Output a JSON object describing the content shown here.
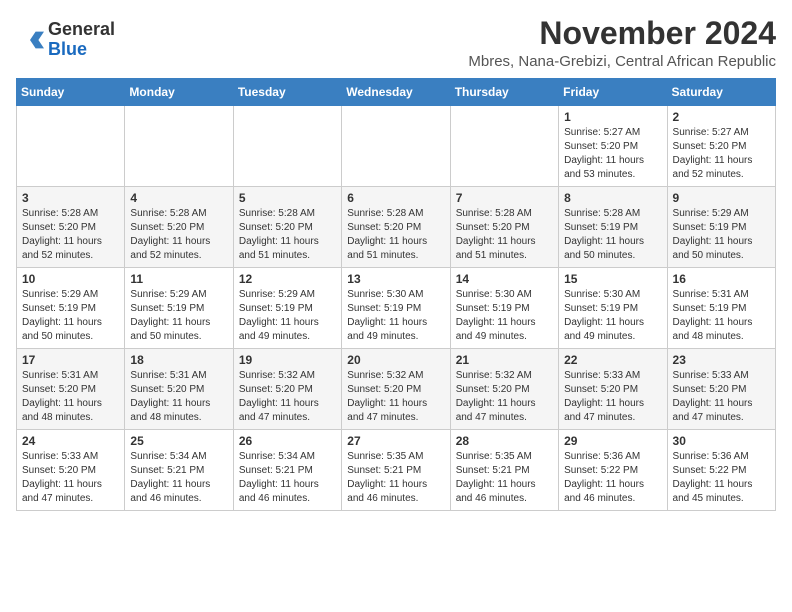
{
  "header": {
    "logo_general": "General",
    "logo_blue": "Blue",
    "month_title": "November 2024",
    "subtitle": "Mbres, Nana-Grebizi, Central African Republic"
  },
  "days_of_week": [
    "Sunday",
    "Monday",
    "Tuesday",
    "Wednesday",
    "Thursday",
    "Friday",
    "Saturday"
  ],
  "weeks": [
    [
      {
        "day": "",
        "info": ""
      },
      {
        "day": "",
        "info": ""
      },
      {
        "day": "",
        "info": ""
      },
      {
        "day": "",
        "info": ""
      },
      {
        "day": "",
        "info": ""
      },
      {
        "day": "1",
        "info": "Sunrise: 5:27 AM\nSunset: 5:20 PM\nDaylight: 11 hours and 53 minutes."
      },
      {
        "day": "2",
        "info": "Sunrise: 5:27 AM\nSunset: 5:20 PM\nDaylight: 11 hours and 52 minutes."
      }
    ],
    [
      {
        "day": "3",
        "info": "Sunrise: 5:28 AM\nSunset: 5:20 PM\nDaylight: 11 hours and 52 minutes."
      },
      {
        "day": "4",
        "info": "Sunrise: 5:28 AM\nSunset: 5:20 PM\nDaylight: 11 hours and 52 minutes."
      },
      {
        "day": "5",
        "info": "Sunrise: 5:28 AM\nSunset: 5:20 PM\nDaylight: 11 hours and 51 minutes."
      },
      {
        "day": "6",
        "info": "Sunrise: 5:28 AM\nSunset: 5:20 PM\nDaylight: 11 hours and 51 minutes."
      },
      {
        "day": "7",
        "info": "Sunrise: 5:28 AM\nSunset: 5:20 PM\nDaylight: 11 hours and 51 minutes."
      },
      {
        "day": "8",
        "info": "Sunrise: 5:28 AM\nSunset: 5:19 PM\nDaylight: 11 hours and 50 minutes."
      },
      {
        "day": "9",
        "info": "Sunrise: 5:29 AM\nSunset: 5:19 PM\nDaylight: 11 hours and 50 minutes."
      }
    ],
    [
      {
        "day": "10",
        "info": "Sunrise: 5:29 AM\nSunset: 5:19 PM\nDaylight: 11 hours and 50 minutes."
      },
      {
        "day": "11",
        "info": "Sunrise: 5:29 AM\nSunset: 5:19 PM\nDaylight: 11 hours and 50 minutes."
      },
      {
        "day": "12",
        "info": "Sunrise: 5:29 AM\nSunset: 5:19 PM\nDaylight: 11 hours and 49 minutes."
      },
      {
        "day": "13",
        "info": "Sunrise: 5:30 AM\nSunset: 5:19 PM\nDaylight: 11 hours and 49 minutes."
      },
      {
        "day": "14",
        "info": "Sunrise: 5:30 AM\nSunset: 5:19 PM\nDaylight: 11 hours and 49 minutes."
      },
      {
        "day": "15",
        "info": "Sunrise: 5:30 AM\nSunset: 5:19 PM\nDaylight: 11 hours and 49 minutes."
      },
      {
        "day": "16",
        "info": "Sunrise: 5:31 AM\nSunset: 5:19 PM\nDaylight: 11 hours and 48 minutes."
      }
    ],
    [
      {
        "day": "17",
        "info": "Sunrise: 5:31 AM\nSunset: 5:20 PM\nDaylight: 11 hours and 48 minutes."
      },
      {
        "day": "18",
        "info": "Sunrise: 5:31 AM\nSunset: 5:20 PM\nDaylight: 11 hours and 48 minutes."
      },
      {
        "day": "19",
        "info": "Sunrise: 5:32 AM\nSunset: 5:20 PM\nDaylight: 11 hours and 47 minutes."
      },
      {
        "day": "20",
        "info": "Sunrise: 5:32 AM\nSunset: 5:20 PM\nDaylight: 11 hours and 47 minutes."
      },
      {
        "day": "21",
        "info": "Sunrise: 5:32 AM\nSunset: 5:20 PM\nDaylight: 11 hours and 47 minutes."
      },
      {
        "day": "22",
        "info": "Sunrise: 5:33 AM\nSunset: 5:20 PM\nDaylight: 11 hours and 47 minutes."
      },
      {
        "day": "23",
        "info": "Sunrise: 5:33 AM\nSunset: 5:20 PM\nDaylight: 11 hours and 47 minutes."
      }
    ],
    [
      {
        "day": "24",
        "info": "Sunrise: 5:33 AM\nSunset: 5:20 PM\nDaylight: 11 hours and 47 minutes."
      },
      {
        "day": "25",
        "info": "Sunrise: 5:34 AM\nSunset: 5:21 PM\nDaylight: 11 hours and 46 minutes."
      },
      {
        "day": "26",
        "info": "Sunrise: 5:34 AM\nSunset: 5:21 PM\nDaylight: 11 hours and 46 minutes."
      },
      {
        "day": "27",
        "info": "Sunrise: 5:35 AM\nSunset: 5:21 PM\nDaylight: 11 hours and 46 minutes."
      },
      {
        "day": "28",
        "info": "Sunrise: 5:35 AM\nSunset: 5:21 PM\nDaylight: 11 hours and 46 minutes."
      },
      {
        "day": "29",
        "info": "Sunrise: 5:36 AM\nSunset: 5:22 PM\nDaylight: 11 hours and 46 minutes."
      },
      {
        "day": "30",
        "info": "Sunrise: 5:36 AM\nSunset: 5:22 PM\nDaylight: 11 hours and 45 minutes."
      }
    ]
  ]
}
